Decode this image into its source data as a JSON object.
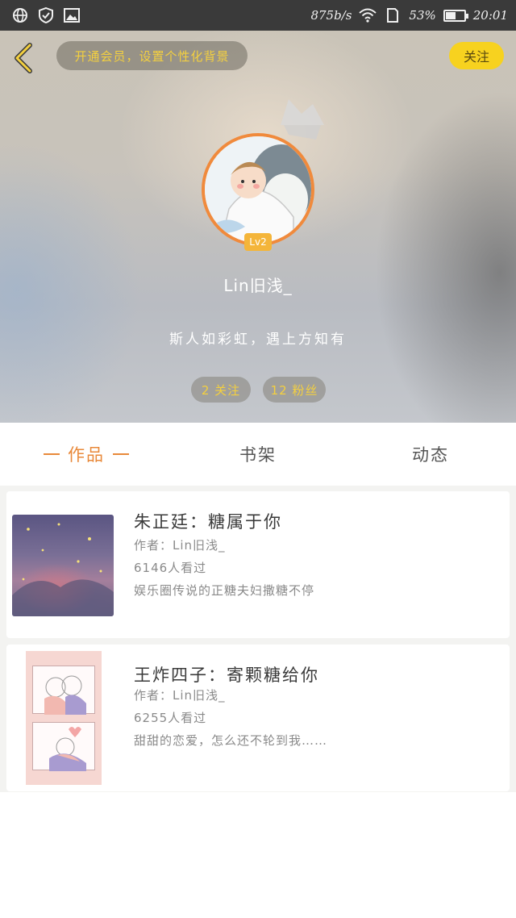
{
  "status_bar": {
    "network_speed": "875b/s",
    "battery_percent": "53%",
    "battery_level": 0.53,
    "time": "20:01",
    "icons": [
      "globe-icon",
      "shield-icon",
      "image-icon",
      "wifi-icon",
      "sim-icon",
      "battery-icon"
    ]
  },
  "header": {
    "vip_banner": "开通会员，设置个性化背景",
    "follow_button": "关注",
    "level_badge": "Lv2",
    "username": "Lin旧浅_",
    "bio": "斯人如彩虹，遇上方知有",
    "stats": {
      "following": "2 关注",
      "followers": "12 粉丝"
    }
  },
  "tabs": {
    "items": [
      {
        "label": "作品",
        "active": true
      },
      {
        "label": "书架",
        "active": false
      },
      {
        "label": "动态",
        "active": false
      }
    ]
  },
  "works": [
    {
      "title": "朱正廷：糖属于你",
      "author": "作者：Lin旧浅_",
      "views": "6146人看过",
      "description": "娱乐圈传说的正糖夫妇撒糖不停"
    },
    {
      "title": "王炸四子：寄颗糖给你",
      "author": "作者：Lin旧浅_",
      "views": "6255人看过",
      "description": "甜甜的恋爱，怎么还不轮到我……"
    }
  ],
  "colors": {
    "accent": "#e8893a",
    "follow_yellow": "#f7d21f",
    "stat_text": "#f4d03f",
    "avatar_border": "#f08a3c"
  }
}
